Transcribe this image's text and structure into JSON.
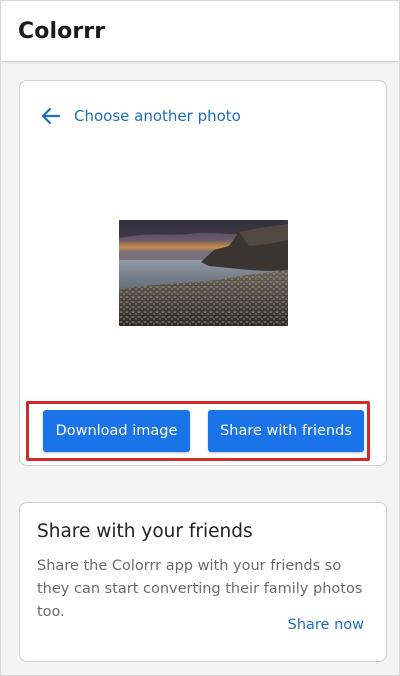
{
  "app_bar": {
    "title": "Colorrr"
  },
  "photo_card": {
    "back_link_label": "Choose another photo",
    "back_icon": "arrow-left-icon",
    "photo_description": "rocky beach seascape at dusk",
    "download_button_label": "Download image",
    "share_button_label": "Share with friends"
  },
  "share_card": {
    "heading": "Share with your friends",
    "body": "Share the Colorrr app with your friends so they can start converting their family photos too.",
    "action_label": "Share now"
  },
  "colors": {
    "accent": "#1a73e8",
    "link": "#1e6fc0",
    "highlight": "#d12a2a"
  }
}
